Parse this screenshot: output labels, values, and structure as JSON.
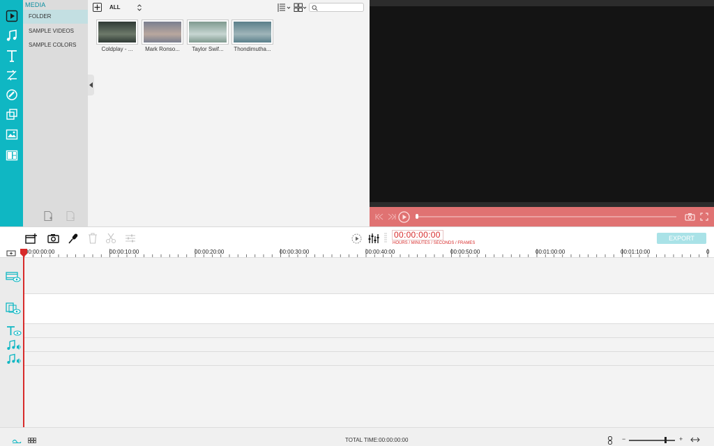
{
  "categories": {
    "header": "MEDIA",
    "items": [
      "FOLDER",
      "SAMPLE VIDEOS",
      "SAMPLE COLORS"
    ]
  },
  "library": {
    "filter_label": "ALL",
    "search_placeholder": "",
    "thumbnails": [
      {
        "label": "Coldplay - ...",
        "color_a": "#2f3a35",
        "color_b": "#6d7a6a"
      },
      {
        "label": "Mark Ronso...",
        "color_a": "#7a7f8f",
        "color_b": "#b9a79e"
      },
      {
        "label": "Taylor Swif...",
        "color_a": "#7f9a8f",
        "color_b": "#c7d6d2"
      },
      {
        "label": "Thondimutha...",
        "color_a": "#5a7f8a",
        "color_b": "#9fb5b9"
      }
    ]
  },
  "timecode": {
    "value": "00:00:00:00",
    "caption": "HOURS / MINUTES / SECONDS / FRAMES"
  },
  "export_label": "EXPORT",
  "ruler": {
    "labels": [
      "00:00:00:00",
      "00:00:10:00",
      "00:00:20:00",
      "00:00:30:00",
      "00:00:40:00",
      "00:00:50:00",
      "00:01:00:00",
      "00:01:10:00",
      "0"
    ]
  },
  "status": {
    "total_time": "TOTAL TIME:00:00:00:00",
    "zoom_level": 0.8
  },
  "colors": {
    "accent": "#0fb7c3",
    "preview_controls": "#e07272",
    "timecode": "#d72a2a",
    "export_button": "#a9e2e7"
  }
}
